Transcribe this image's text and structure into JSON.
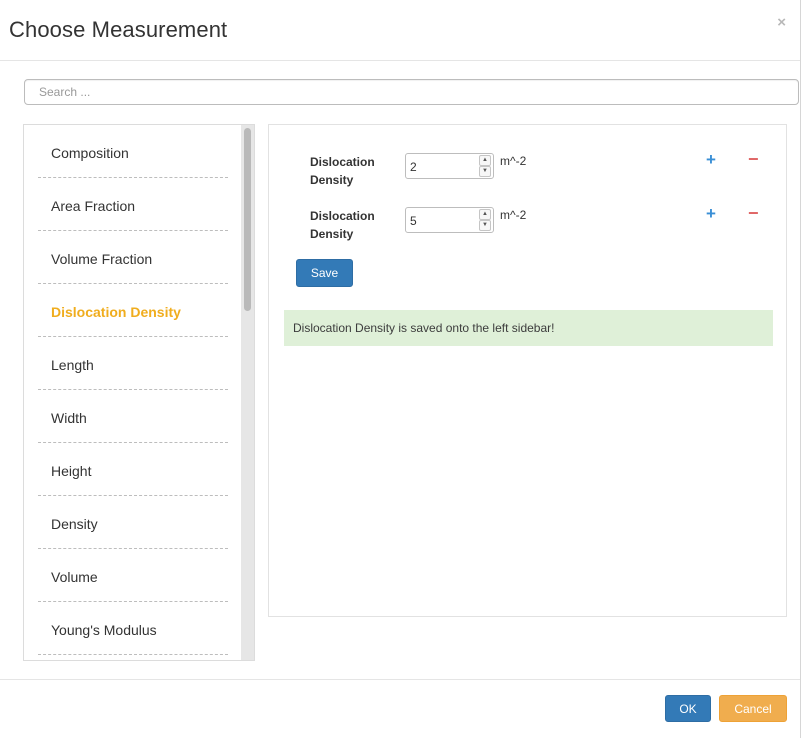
{
  "dialog": {
    "title": "Choose Measurement",
    "close_glyph": "×"
  },
  "search": {
    "placeholder": "Search ...",
    "value": ""
  },
  "measurements": {
    "items": [
      {
        "label": "Composition",
        "active": false
      },
      {
        "label": "Area Fraction",
        "active": false
      },
      {
        "label": "Volume Fraction",
        "active": false
      },
      {
        "label": "Dislocation Density",
        "active": true
      },
      {
        "label": "Length",
        "active": false
      },
      {
        "label": "Width",
        "active": false
      },
      {
        "label": "Height",
        "active": false
      },
      {
        "label": "Density",
        "active": false
      },
      {
        "label": "Volume",
        "active": false
      },
      {
        "label": "Young's Modulus",
        "active": false
      }
    ]
  },
  "form": {
    "rows": [
      {
        "label": "Dislocation Density",
        "value": "2",
        "unit": "m^-2"
      },
      {
        "label": "Dislocation Density",
        "value": "5",
        "unit": "m^-2"
      }
    ],
    "plus_glyph": "+",
    "minus_glyph": "−",
    "spin_up": "▲",
    "spin_down": "▼",
    "save_label": "Save",
    "alert_text": "Dislocation Density is saved onto the left sidebar!"
  },
  "footer": {
    "ok_label": "OK",
    "cancel_label": "Cancel"
  },
  "colors": {
    "primary": "#337ab7",
    "warning": "#f0ad4e",
    "active_item": "#f0ad1e",
    "success_bg": "#dff0d8",
    "plus": "#3a8fd6",
    "minus": "#e06666"
  }
}
